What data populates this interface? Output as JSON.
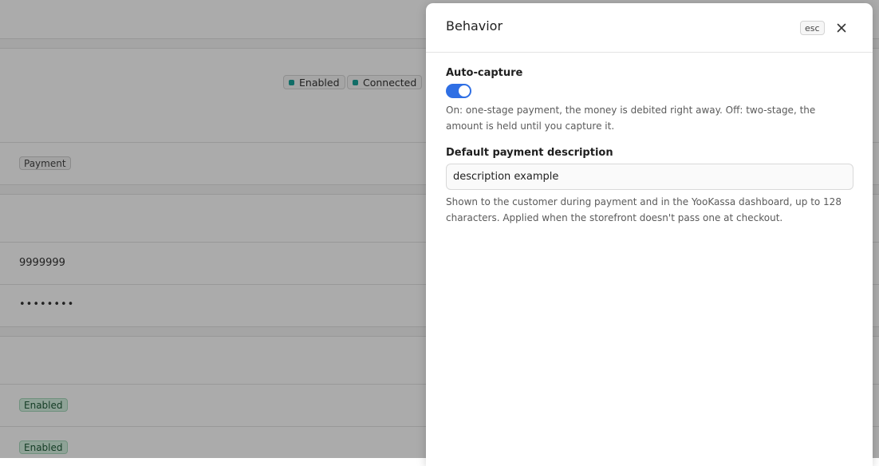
{
  "background": {
    "status_chips": [
      "Enabled",
      "Connected"
    ],
    "payment_tag": "Payment",
    "shop_id_value": "9999999",
    "secret_key_value": "••••••••",
    "enabled_tags": [
      "Enabled",
      "Enabled"
    ]
  },
  "drawer": {
    "title": "Behavior",
    "esc_label": "esc",
    "close_icon": "close-icon",
    "auto_capture": {
      "label": "Auto-capture",
      "enabled": true,
      "help": "On: one-stage payment, the money is debited right away. Off: two-stage, the amount is held until you capture it."
    },
    "description": {
      "label": "Default payment description",
      "value": "description example",
      "help": "Shown to the customer during payment and in the YooKassa dashboard, up to 128 characters. Applied when the storefront doesn't pass one at checkout."
    }
  },
  "colors": {
    "accent": "#2f6fe4",
    "status_dot": "#1aa39a",
    "enabled_tag_bg": "#d6f2e2"
  }
}
